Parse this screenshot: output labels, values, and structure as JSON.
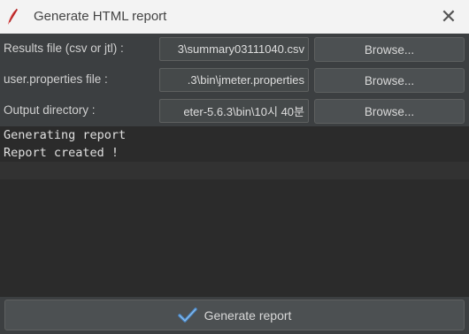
{
  "window": {
    "title": "Generate HTML report",
    "icon": "feather-icon",
    "close_symbol": "✕"
  },
  "fields": [
    {
      "label": "Results file (csv or jtl) :",
      "value": "3\\summary03111040.csv",
      "button": "Browse..."
    },
    {
      "label": "user.properties file :",
      "value": ".3\\bin\\jmeter.properties",
      "button": "Browse..."
    },
    {
      "label": "Output directory :",
      "value": "eter-5.6.3\\bin\\10시 40분",
      "button": "Browse..."
    }
  ],
  "log": {
    "lines": [
      "Generating report",
      "Report created !"
    ]
  },
  "actions": {
    "generate_label": "Generate report",
    "generate_icon": "checkmark-icon"
  },
  "colors": {
    "background": "#3c3f41",
    "log_background": "#2b2b2b",
    "titlebar": "#f3f3f3",
    "check_icon": "#4a88c7"
  }
}
